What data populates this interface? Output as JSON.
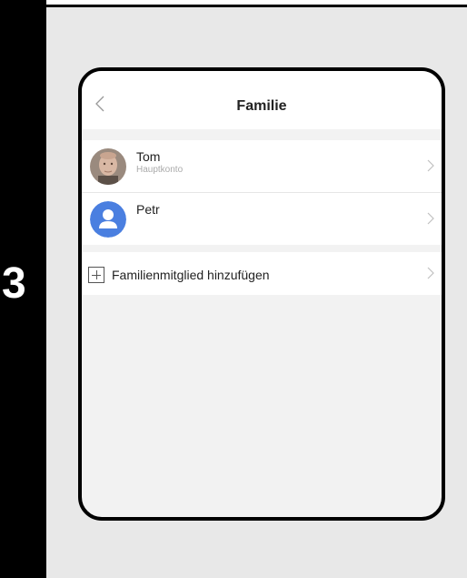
{
  "step": {
    "number": "3"
  },
  "screen": {
    "title": "Familie",
    "members": [
      {
        "name": "Tom",
        "role": "Hauptkonto",
        "avatar": "photo-avatar"
      },
      {
        "name": "Petr",
        "role": "",
        "avatar": "default-user-icon"
      }
    ],
    "add_member_label": "Familienmitglied hinzufügen"
  },
  "colors": {
    "accent": "#4a7fe0",
    "background": "#f2f2f2"
  },
  "icons": [
    "back-arrow-icon",
    "chevron-right-icon",
    "plus-icon",
    "user-icon"
  ]
}
